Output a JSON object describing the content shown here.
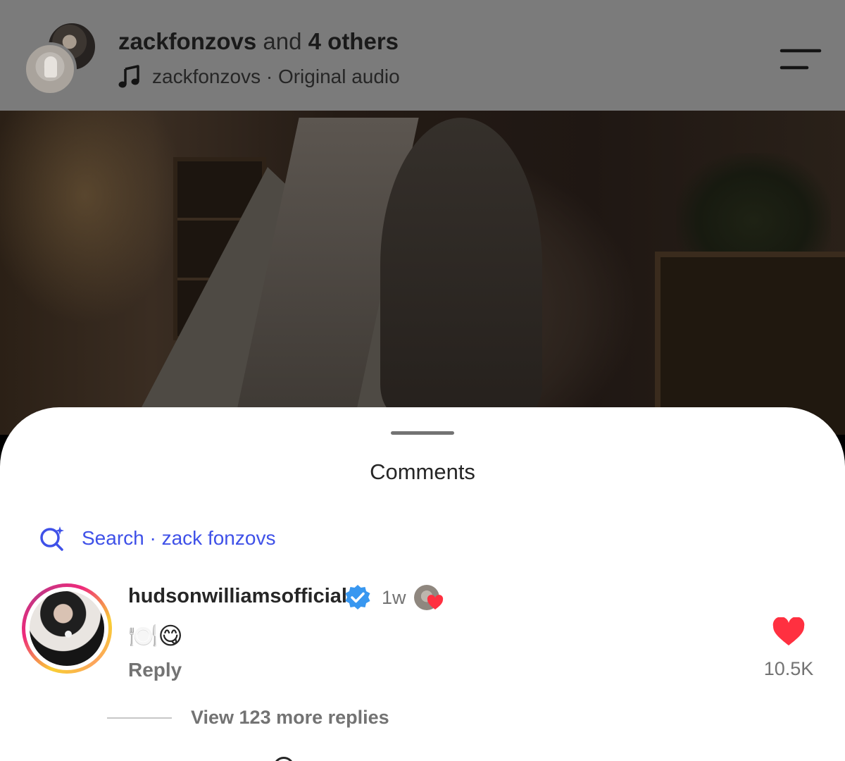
{
  "header": {
    "title_user": "zackfonzovs",
    "title_and": "and",
    "title_others": "4 others",
    "audio_label": "zackfonzovs · Original audio",
    "icons": {
      "audio": "music-note-icon",
      "menu": "menu-icon"
    }
  },
  "comments_panel": {
    "title": "Comments",
    "search_label": "Search · zack fonzovs",
    "search_icon": "ai-search-icon",
    "accent_color": "#3f51e8"
  },
  "comment": {
    "username": "hudsonwilliamsofficial",
    "verified": true,
    "time": "1w",
    "body": "🍽️😋",
    "reply_label": "Reply",
    "like_count": "10.5K",
    "liked": true,
    "like_color": "#ff3040",
    "view_replies_label": "View 123 more replies"
  }
}
